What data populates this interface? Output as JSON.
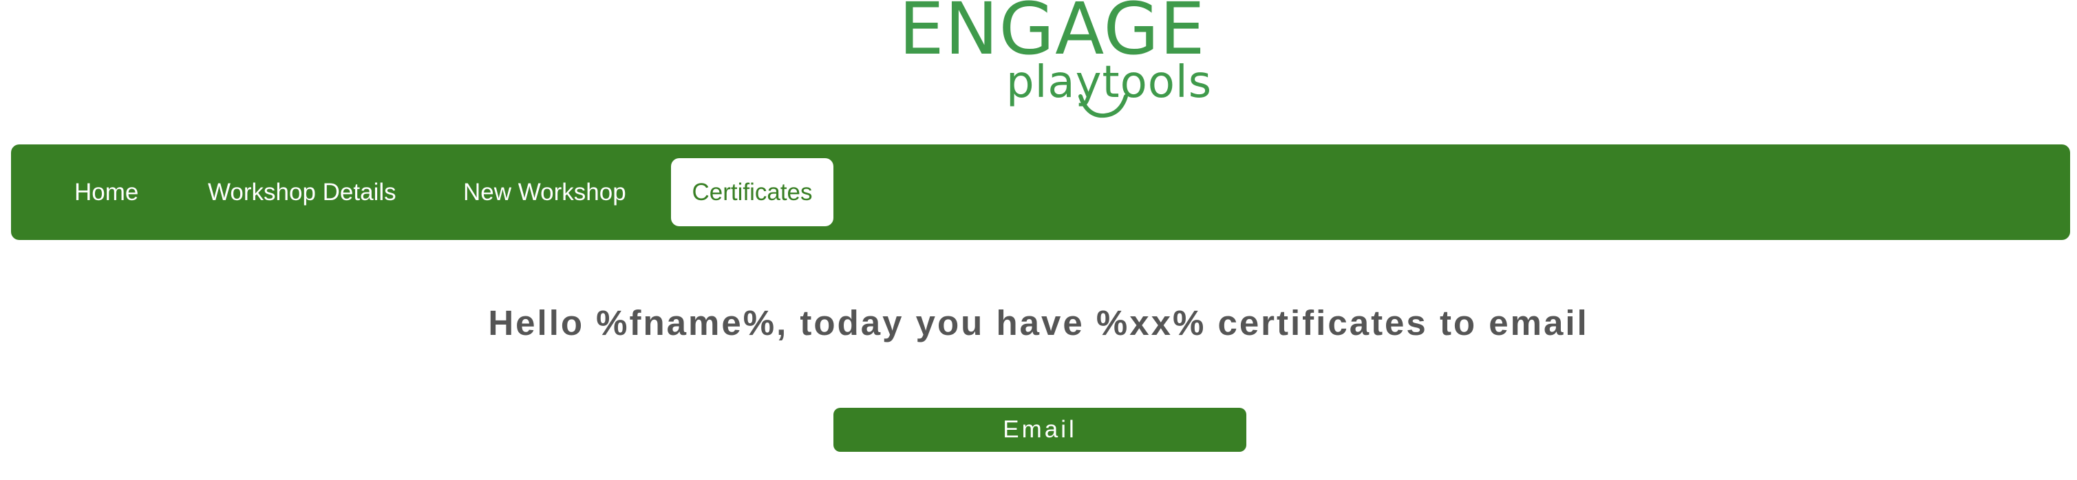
{
  "logo": {
    "word": "ENGAGE",
    "sub": "playtools",
    "color": "#3f9a4b"
  },
  "nav": {
    "items": [
      {
        "label": "Home"
      },
      {
        "label": "Workshop Details"
      },
      {
        "label": "New Workshop"
      },
      {
        "label": "Certificates",
        "active": true
      }
    ],
    "background": "#387f24",
    "text_color": "#ffffff"
  },
  "main": {
    "greeting": "Hello %fname%, today you have %xx% certificates to email",
    "email_button_label": "Email"
  }
}
